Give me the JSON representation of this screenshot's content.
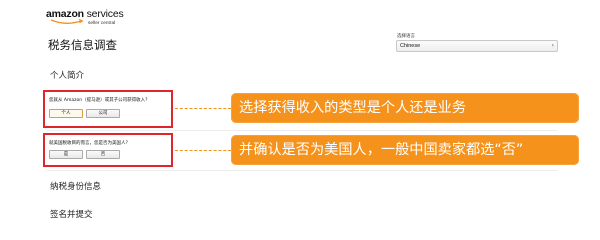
{
  "brand": {
    "name_bold": "amazon",
    "name_rest": " services",
    "sub": "seller central"
  },
  "page": {
    "title": "税务信息调查"
  },
  "language": {
    "label": "选择语言",
    "value": "Chinese",
    "chevron": "›"
  },
  "sections": {
    "personal": "个人简介",
    "tax_id": "纳税身份信息",
    "sign": "签名并提交"
  },
  "questions": [
    {
      "text": "您就从 Amazon（提马逊）或其子公司获得收入？",
      "options": [
        "个人",
        "公司"
      ],
      "selected": 0
    },
    {
      "text": "就美国税收目的而言，您是否为美国人？",
      "options": [
        "是",
        "否"
      ],
      "selected": null
    }
  ],
  "callouts": [
    "选择获得收入的类型是个人还是业务",
    "并确认是否为美国人，一般中国卖家都选“否”"
  ],
  "colors": {
    "highlight_border": "#e0262b",
    "callout_bg": "#f5921b",
    "callout_text": "#ffffff"
  },
  "icons": {
    "brand_smile": "amazon-smile-icon",
    "dropdown": "chevron-down-icon"
  }
}
